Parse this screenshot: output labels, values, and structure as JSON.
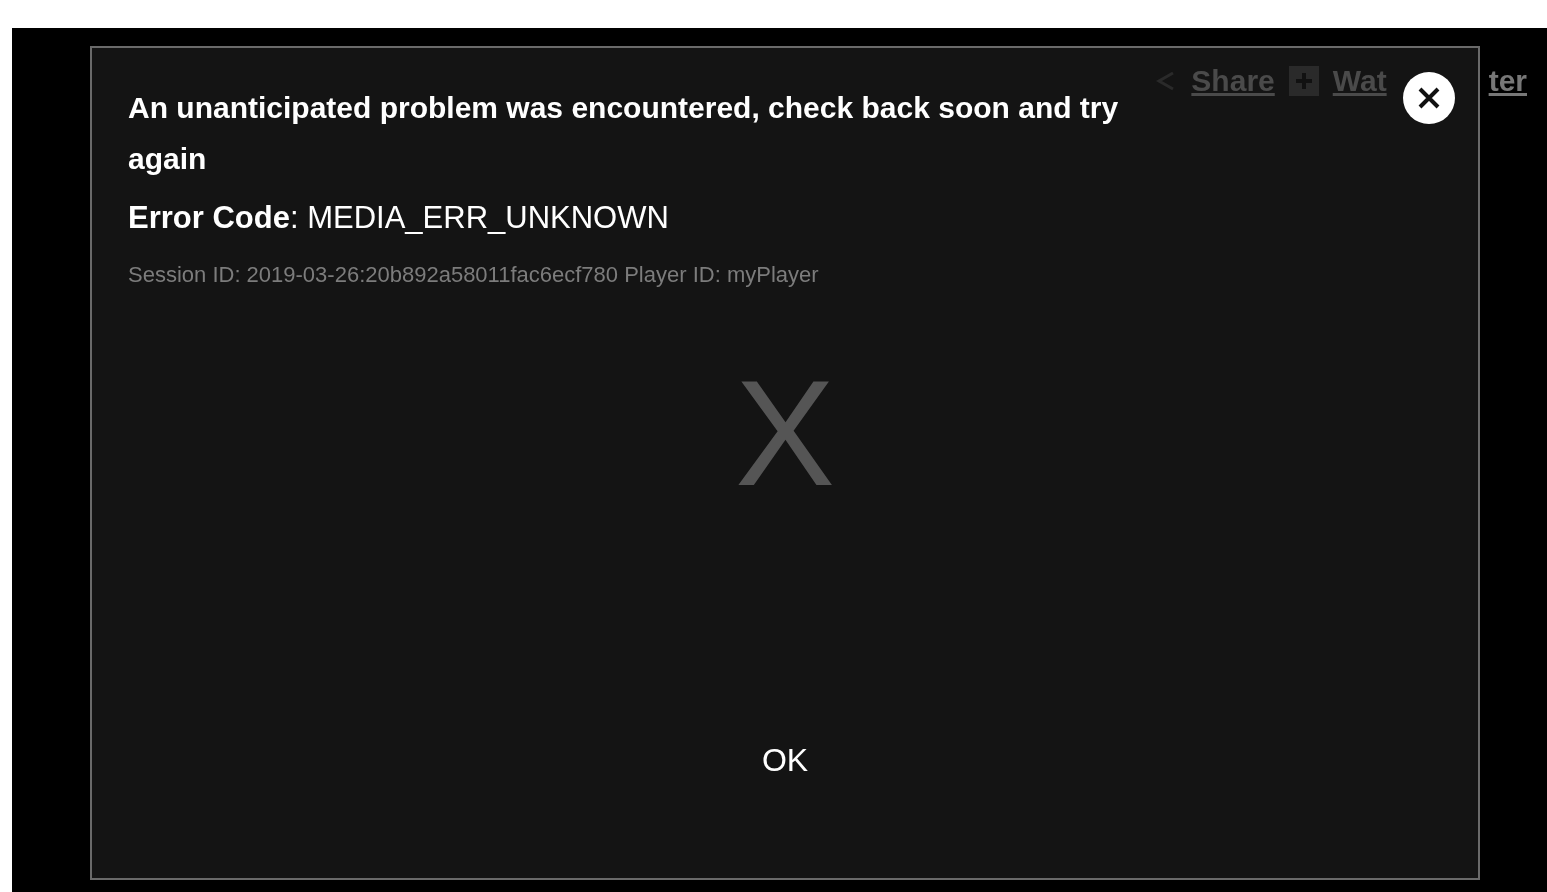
{
  "player_controls": {
    "share": "Share",
    "watch_later_start": "Wat",
    "watch_later_end": "ter"
  },
  "dialog": {
    "message": "An unanticipated problem was encountered, check back soon and try again",
    "error_label": "Error Code",
    "error_code": ": MEDIA_ERR_UNKNOWN",
    "session": "Session ID: 2019-03-26:20b892a58011fac6ecf780 Player ID: myPlayer",
    "glyph": "X",
    "button": "OK"
  }
}
